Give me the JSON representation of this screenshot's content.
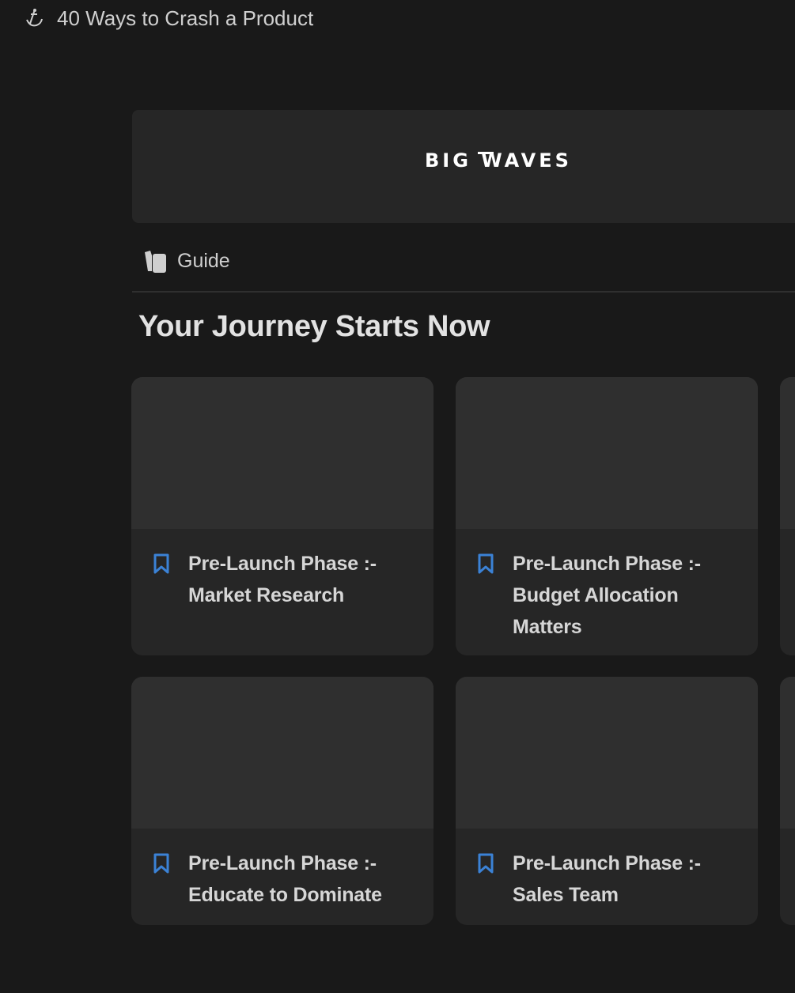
{
  "window": {
    "title": "40 Ways to Crash a Product",
    "icon": "anchor-icon"
  },
  "cover": {
    "logo_text": "BIG WAVES"
  },
  "view": {
    "tab_label": "Guide",
    "tab_icon": "pages-icon"
  },
  "section": {
    "title": "Your Journey Starts Now"
  },
  "cards": [
    {
      "title_line1": "Pre-Launch Phase :-",
      "title_line2": "Market Research",
      "title_line3": "",
      "icon": "bookmark-icon"
    },
    {
      "title_line1": "Pre-Launch Phase :-",
      "title_line2": "Budget Allocation",
      "title_line3": "Matters",
      "icon": "bookmark-icon"
    },
    {
      "title_line1": "Pre-Launch Phase :-",
      "title_line2": "Educate to Dominate",
      "title_line3": "",
      "icon": "bookmark-icon"
    },
    {
      "title_line1": "Pre-Launch Phase :-",
      "title_line2": "Sales Team",
      "title_line3": "",
      "icon": "bookmark-icon"
    }
  ],
  "colors": {
    "background": "#191919",
    "card": "#262626",
    "card_cover": "#2f2f2f",
    "accent": "#3b82d6"
  }
}
